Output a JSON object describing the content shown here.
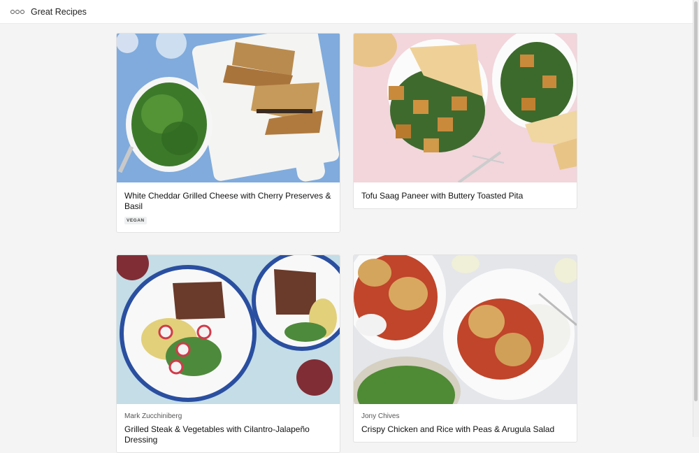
{
  "app": {
    "title": "Great Recipes"
  },
  "recipes": [
    {
      "title": "White Cheddar Grilled Cheese with Cherry Preserves & Basil",
      "author": "",
      "tag": "VEGAN",
      "photo_icon": "grilled-cheese-photo"
    },
    {
      "title": "Tofu Saag Paneer with Buttery Toasted Pita",
      "author": "",
      "tag": "",
      "photo_icon": "saag-paneer-photo"
    },
    {
      "title": "Grilled Steak & Vegetables with Cilantro-Jalapeño Dressing",
      "author": "Mark Zucchiniberg",
      "tag": "",
      "photo_icon": "grilled-steak-photo"
    },
    {
      "title": "Crispy Chicken and Rice with Peas & Arugula Salad",
      "author": "Jony Chives",
      "tag": "",
      "photo_icon": "crispy-chicken-photo"
    }
  ],
  "colors": {
    "page_background": "#f4f4f4",
    "card_background": "#ffffff",
    "tag_background": "#eef0f1"
  }
}
